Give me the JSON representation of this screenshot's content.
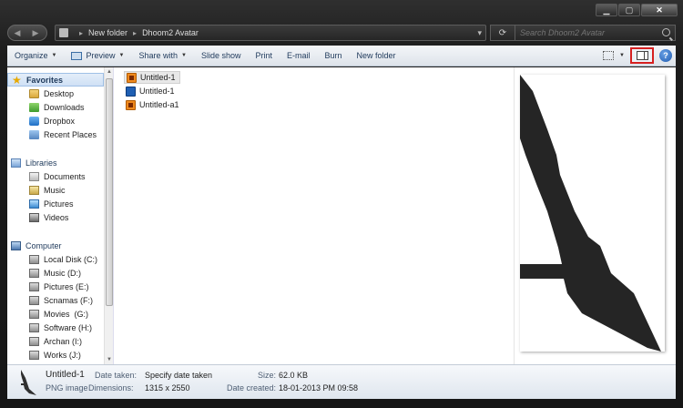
{
  "window": {
    "caption": {
      "minimize": "▁",
      "maximize": "▢",
      "close": "✕"
    }
  },
  "nav": {
    "back": "◀",
    "forward": "▶"
  },
  "breadcrumbs": [
    "New folder",
    "Dhoom2 Avatar"
  ],
  "address_controls": {
    "dropdown": "▾",
    "refresh": "⟳"
  },
  "search": {
    "placeholder": "Search Dhoom2 Avatar"
  },
  "toolbar": {
    "organize": "Organize",
    "preview": "Preview",
    "share_with": "Share with",
    "slide_show": "Slide show",
    "print": "Print",
    "email": "E-mail",
    "burn": "Burn",
    "new_folder": "New folder",
    "help": "?"
  },
  "sidebar": {
    "favorites": {
      "label": "Favorites",
      "items": [
        {
          "label": "Desktop",
          "icon": "desktop-icon"
        },
        {
          "label": "Downloads",
          "icon": "downloads-icon"
        },
        {
          "label": "Dropbox",
          "icon": "dropbox-icon"
        },
        {
          "label": "Recent Places",
          "icon": "recent-places-icon"
        }
      ]
    },
    "libraries": {
      "label": "Libraries",
      "items": [
        {
          "label": "Documents",
          "icon": "documents-icon"
        },
        {
          "label": "Music",
          "icon": "music-icon"
        },
        {
          "label": "Pictures",
          "icon": "pictures-icon"
        },
        {
          "label": "Videos",
          "icon": "videos-icon"
        }
      ]
    },
    "computer": {
      "label": "Computer",
      "items": [
        {
          "label": "Local Disk (C:)",
          "icon": "disk-icon"
        },
        {
          "label": "Music (D:)",
          "icon": "disk-icon"
        },
        {
          "label": "Pictures (E:)",
          "icon": "disk-icon"
        },
        {
          "label": "Scnamas (F:)",
          "icon": "disk-icon"
        },
        {
          "label": "Movies  (G:)",
          "icon": "disk-icon"
        },
        {
          "label": "Software (H:)",
          "icon": "disk-icon"
        },
        {
          "label": "Archan (I:)",
          "icon": "disk-icon"
        },
        {
          "label": "Works (J:)",
          "icon": "disk-icon"
        }
      ]
    }
  },
  "files": [
    {
      "name": "Untitled-1",
      "type": "illustrator",
      "selected": true
    },
    {
      "name": "Untitled-1",
      "type": "photoshop",
      "selected": false
    },
    {
      "name": "Untitled-a1",
      "type": "illustrator",
      "selected": false
    }
  ],
  "details": {
    "name": "Untitled-1",
    "type": "PNG image",
    "date_taken_label": "Date taken:",
    "date_taken_value": "Specify date taken",
    "dimensions_label": "Dimensions:",
    "dimensions_value": "1315 x 2550",
    "size_label": "Size:",
    "size_value": "62.0 KB",
    "date_created_label": "Date created:",
    "date_created_value": "18-01-2013 PM 09:58"
  },
  "colors": {
    "highlight_box": "#d62020",
    "toolbar_text": "#1e395b",
    "preview_shape": "#252525"
  }
}
